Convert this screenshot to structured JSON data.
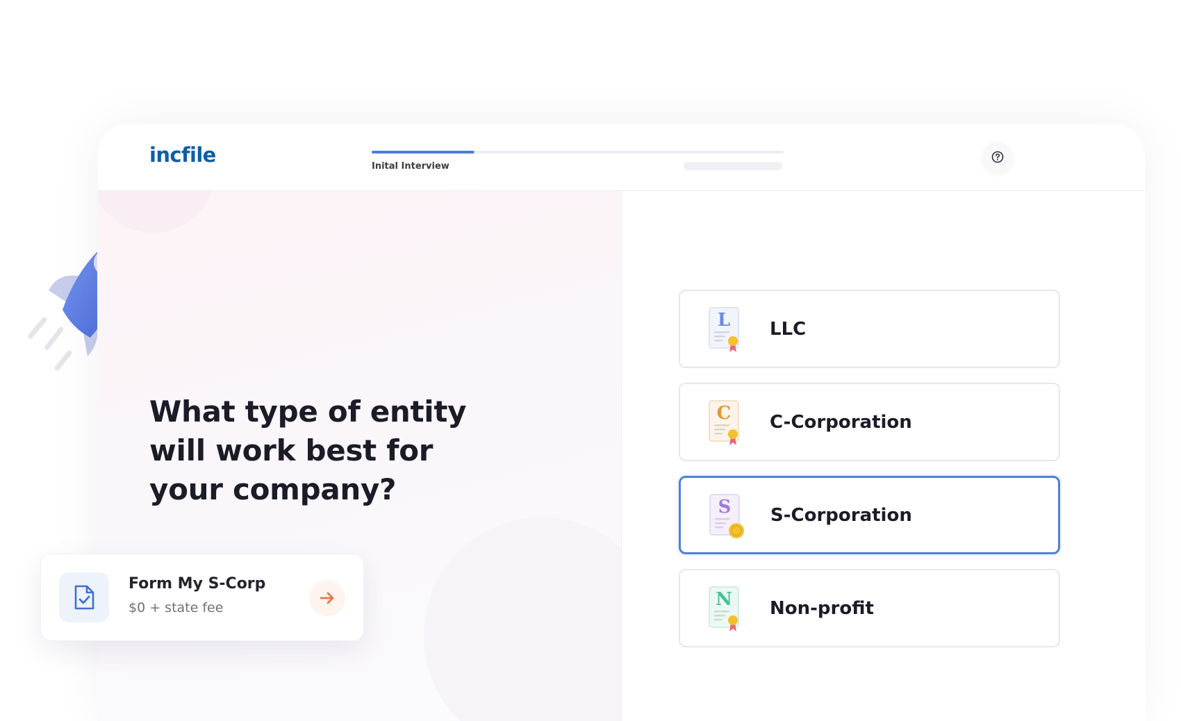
{
  "brand": {
    "logo_text": "incfile"
  },
  "progress": {
    "current_step_label": "Inital Interview",
    "total_steps": 4,
    "current_step": 1
  },
  "help": {
    "icon": "question-circle-icon"
  },
  "question": {
    "text": "What type of entity will work best for your company?"
  },
  "cta": {
    "title": "Form My S-Corp",
    "subtitle": "$0 + state fee",
    "icon": "document-check-icon",
    "arrow_icon": "arrow-right-icon"
  },
  "options": [
    {
      "label": "LLC",
      "letter": "L",
      "selected": false
    },
    {
      "label": "C-Corporation",
      "letter": "C",
      "selected": false
    },
    {
      "label": "S-Corporation",
      "letter": "S",
      "selected": true
    },
    {
      "label": "Non-profit",
      "letter": "N",
      "selected": false
    }
  ],
  "colors": {
    "brand_blue": "#0d5ea8",
    "accent_blue": "#4a7ed9",
    "cta_orange": "#e8774a",
    "letter_llc": "#6d8ae0",
    "letter_ccorp": "#e39a2e",
    "letter_scorp": "#a17ad6",
    "letter_nonprofit": "#42c294",
    "seal_gold": "#f2c12e"
  }
}
